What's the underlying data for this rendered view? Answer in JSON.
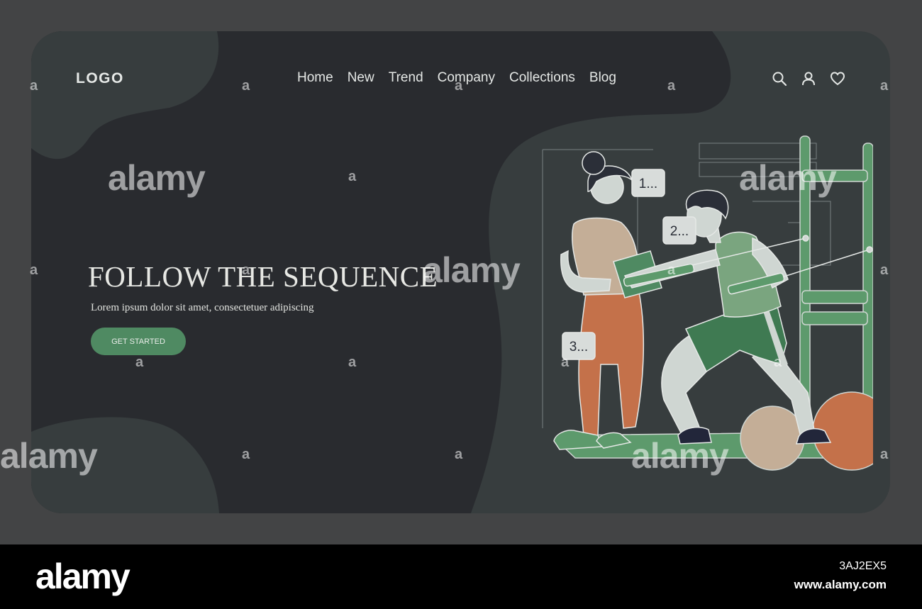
{
  "header": {
    "logo": "LOGO",
    "nav": [
      {
        "label": "Home"
      },
      {
        "label": "New"
      },
      {
        "label": "Trend"
      },
      {
        "label": "Company"
      },
      {
        "label": "Collections"
      },
      {
        "label": "Blog"
      }
    ],
    "icons": [
      "search-icon",
      "user-icon",
      "heart-icon"
    ]
  },
  "hero": {
    "title": "FOLLOW THE SEQUENCE",
    "subtitle": "Lorem ipsum dolor sit amet, consectetuer adipiscing",
    "cta_label": "GET STARTED"
  },
  "illustration": {
    "steps": [
      "1...",
      "2...",
      "3..."
    ]
  },
  "watermark": {
    "text": "alamy"
  },
  "footer": {
    "brand": "alamy",
    "image_id": "3AJ2EX5",
    "url": "www.alamy.com"
  },
  "colors": {
    "page_bg": "#434445",
    "card_bg": "#373d3e",
    "dark_blob": "#292b2f",
    "accent_green": "#4f8a62",
    "orange": "#c4714a",
    "footer_bg": "#000000"
  }
}
